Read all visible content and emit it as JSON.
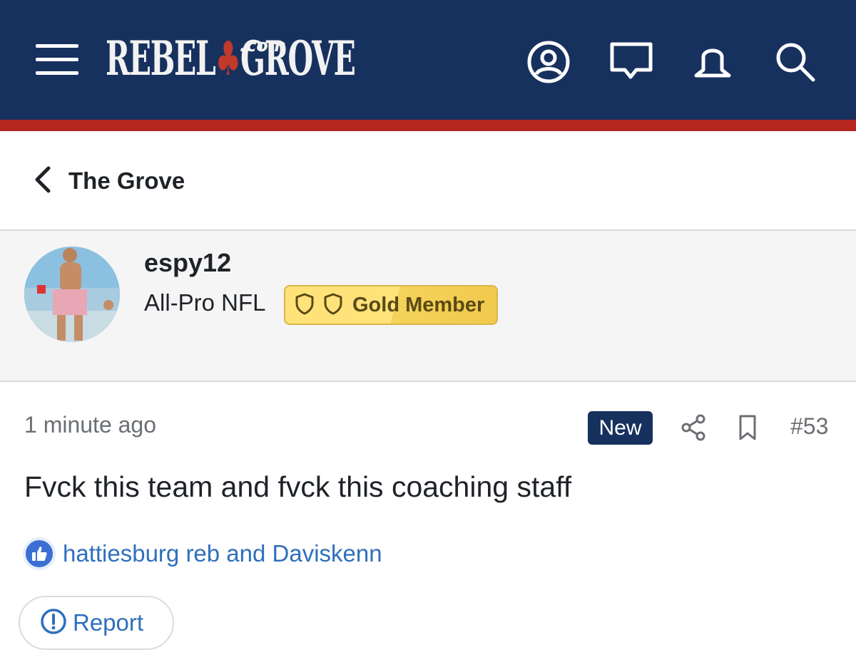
{
  "header": {
    "logo_text": "REBEL",
    "logo_text2": "GROVE",
    "logo_suffix": ".com",
    "icons": [
      "menu-icon",
      "user-icon",
      "chat-icon",
      "bell-icon",
      "search-icon"
    ],
    "colors": {
      "bar": "#17315f",
      "stripe": "#b5261e"
    }
  },
  "breadcrumb": {
    "label": "The Grove",
    "icon": "chevron-left-icon"
  },
  "author": {
    "username": "espy12",
    "title": "All-Pro NFL",
    "badge": "Gold Member",
    "badge_icons": [
      "shield-icon",
      "shield-icon"
    ]
  },
  "post": {
    "timestamp": "1 minute ago",
    "new_label": "New",
    "number": "#53",
    "body": "Fvck this team and fvck this coaching staff",
    "reactions": "hattiesburg reb and Daviskenn",
    "report_label": "Report"
  }
}
